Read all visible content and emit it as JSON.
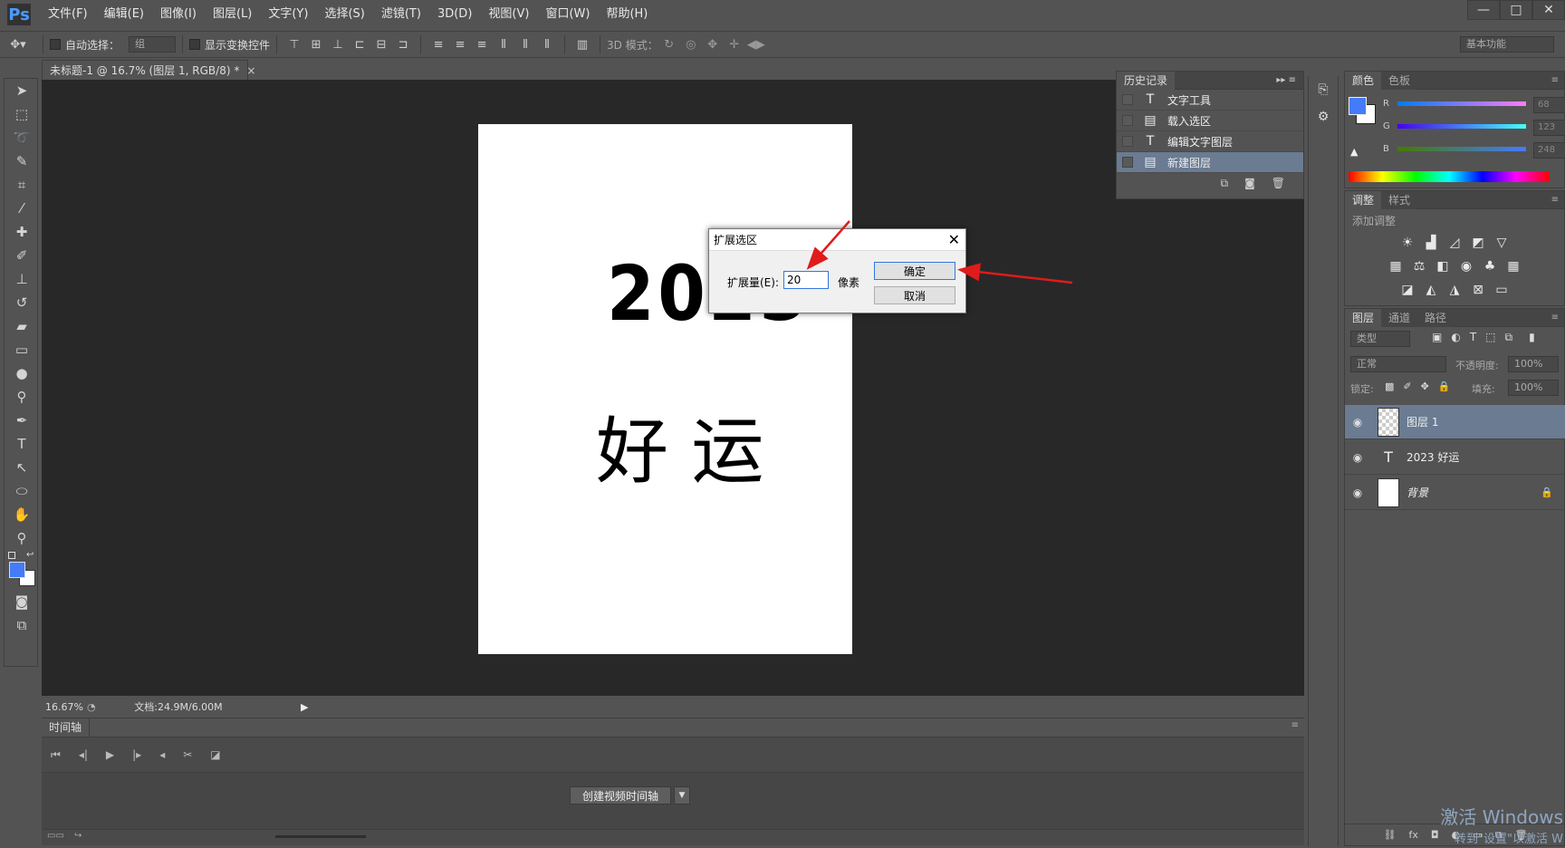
{
  "menubar": {
    "logo": "Ps",
    "items": [
      "文件(F)",
      "编辑(E)",
      "图像(I)",
      "图层(L)",
      "文字(Y)",
      "选择(S)",
      "滤镜(T)",
      "3D(D)",
      "视图(V)",
      "窗口(W)",
      "帮助(H)"
    ]
  },
  "window_controls": {
    "minimize": "—",
    "restore": "□",
    "close": "✕"
  },
  "options_bar": {
    "auto_select_label": "自动选择：",
    "auto_select_value": "组",
    "show_transform_label": "显示变换控件",
    "mode_3d_label": "3D 模式：",
    "workspace": "基本功能"
  },
  "document": {
    "tab_title": "未标题-1 @ 16.7% (图层 1, RGB/8) *",
    "text_line1": "2023",
    "text_line2": "好 运"
  },
  "status": {
    "zoom": "16.67%",
    "doc_info": "文档:24.9M/6.00M"
  },
  "timeline": {
    "tab": "时间轴",
    "create_button": "创建视频时间轴"
  },
  "history": {
    "tab": "历史记录",
    "items": [
      {
        "icon": "T",
        "label": "文字工具"
      },
      {
        "icon": "▤",
        "label": "载入选区"
      },
      {
        "icon": "T",
        "label": "编辑文字图层"
      },
      {
        "icon": "▤",
        "label": "新建图层"
      }
    ]
  },
  "dialog": {
    "title": "扩展选区",
    "expand_label": "扩展量(E):",
    "expand_value": "20",
    "unit": "像素",
    "ok": "确定",
    "cancel": "取消"
  },
  "color_panel": {
    "tabs": [
      "颜色",
      "色板"
    ],
    "channels": [
      {
        "label": "R",
        "value": "68"
      },
      {
        "label": "G",
        "value": "123"
      },
      {
        "label": "B",
        "value": "248"
      }
    ],
    "foreground": "#447bf8"
  },
  "adjust_panel": {
    "tabs": [
      "调整",
      "样式"
    ],
    "title": "添加调整"
  },
  "layers_panel": {
    "tabs": [
      "图层",
      "通道",
      "路径"
    ],
    "filter": "类型",
    "blend_mode": "正常",
    "opacity_label": "不透明度:",
    "opacity_value": "100%",
    "lock_label": "锁定:",
    "fill_label": "填充:",
    "fill_value": "100%",
    "layers": [
      {
        "name": "图层 1"
      },
      {
        "name": "2023 好运"
      },
      {
        "name": "背景"
      }
    ]
  },
  "watermark": {
    "line1": "激活 Windows",
    "line2": "转到\"设置\"以激活 W"
  }
}
